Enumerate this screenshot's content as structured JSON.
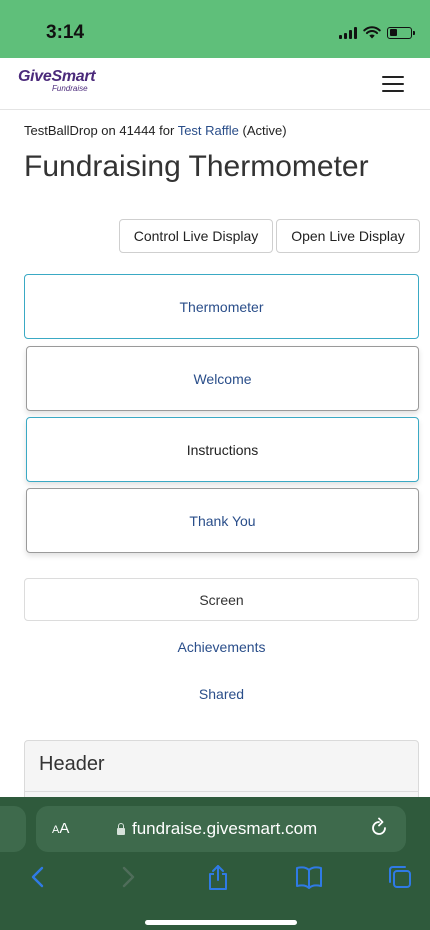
{
  "status_bar": {
    "time": "3:14",
    "battery_level": 0.35
  },
  "header": {
    "logo_main": "GiveSmart",
    "logo_sub": "Fundraise",
    "menu_icon": "hamburger-icon"
  },
  "breadcrumb": {
    "prefix": "TestBallDrop on 41444 for ",
    "link": "Test Raffle",
    "suffix": " (Active)"
  },
  "page": {
    "title": "Fundraising Thermometer"
  },
  "live_display": {
    "control_label": "Control Live Display",
    "open_label": "Open Live Display"
  },
  "screens": [
    {
      "label": "Thermometer",
      "active": true
    },
    {
      "label": "Welcome",
      "active": false
    },
    {
      "label": "Instructions",
      "active": true
    },
    {
      "label": "Thank You",
      "active": false
    }
  ],
  "tabs": {
    "screen": "Screen",
    "achievements": "Achievements",
    "shared": "Shared"
  },
  "panel": {
    "title": "Header"
  },
  "browser": {
    "text_size_label_small": "A",
    "text_size_label_large": "A",
    "url": "fundraise.givesmart.com",
    "icons": [
      "back-icon",
      "forward-icon",
      "share-icon",
      "bookmarks-icon",
      "tabs-icon"
    ]
  },
  "colors": {
    "status_bar": "#5fbf7a",
    "brand": "#4b2a7b",
    "link": "#2a4e8a",
    "active_border": "#3aa9c4",
    "safari_bar": "#2f5a3c"
  }
}
